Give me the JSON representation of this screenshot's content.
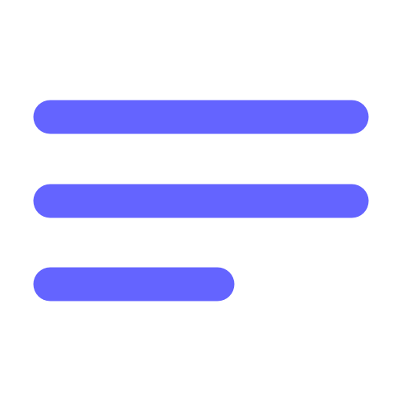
{
  "icon": {
    "name": "menu-icon",
    "color": "#6464FF",
    "background": "#FFFFFF",
    "lines": [
      {
        "name": "menu-line-top"
      },
      {
        "name": "menu-line-middle"
      },
      {
        "name": "menu-line-bottom"
      }
    ]
  }
}
